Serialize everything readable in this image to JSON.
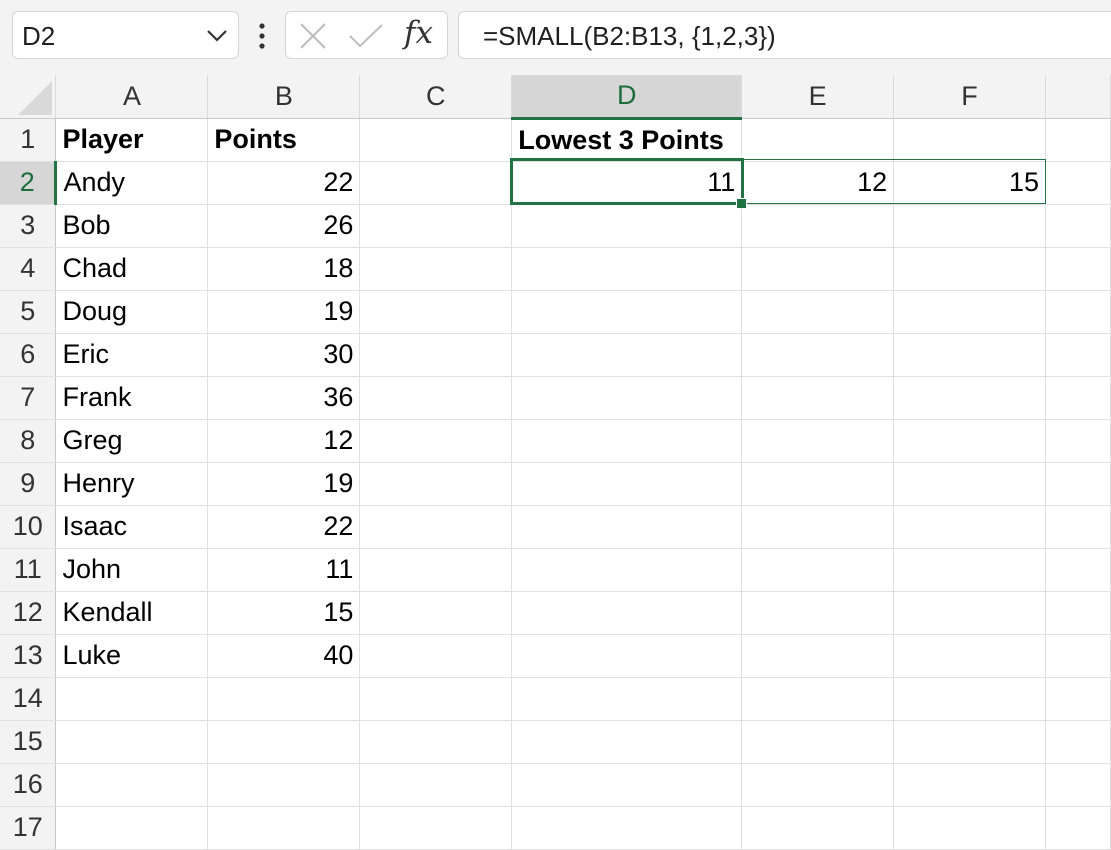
{
  "formula_bar": {
    "name_box": "D2",
    "fx_label": "fx",
    "formula": "=SMALL(B2:B13, {1,2,3})"
  },
  "columns": [
    "A",
    "B",
    "C",
    "D",
    "E",
    "F"
  ],
  "rows": [
    {
      "num": "1",
      "A": "Player",
      "B": "Points",
      "D": "Lowest 3 Points"
    },
    {
      "num": "2",
      "A": "Andy",
      "B": "22",
      "D": "11",
      "E": "12",
      "F": "15"
    },
    {
      "num": "3",
      "A": "Bob",
      "B": "26"
    },
    {
      "num": "4",
      "A": "Chad",
      "B": "18"
    },
    {
      "num": "5",
      "A": "Doug",
      "B": "19"
    },
    {
      "num": "6",
      "A": "Eric",
      "B": "30"
    },
    {
      "num": "7",
      "A": "Frank",
      "B": "36"
    },
    {
      "num": "8",
      "A": "Greg",
      "B": "12"
    },
    {
      "num": "9",
      "A": "Henry",
      "B": "19"
    },
    {
      "num": "10",
      "A": "Isaac",
      "B": "22"
    },
    {
      "num": "11",
      "A": "John",
      "B": "11"
    },
    {
      "num": "12",
      "A": "Kendall",
      "B": "15"
    },
    {
      "num": "13",
      "A": "Luke",
      "B": "40"
    },
    {
      "num": "14"
    },
    {
      "num": "15"
    },
    {
      "num": "16"
    },
    {
      "num": "17"
    }
  ],
  "selection": {
    "active_cell": "D2",
    "range": "D2:F2"
  },
  "colors": {
    "accent": "#217346",
    "header_bg": "#f3f3f3",
    "grid_line": "#e1e1e1"
  },
  "icons": {
    "name_box_dropdown": "chevron-down-icon",
    "more": "vertical-dots-icon",
    "cancel": "cancel-x-icon",
    "enter": "checkmark-icon",
    "insert_function": "fx-icon"
  }
}
